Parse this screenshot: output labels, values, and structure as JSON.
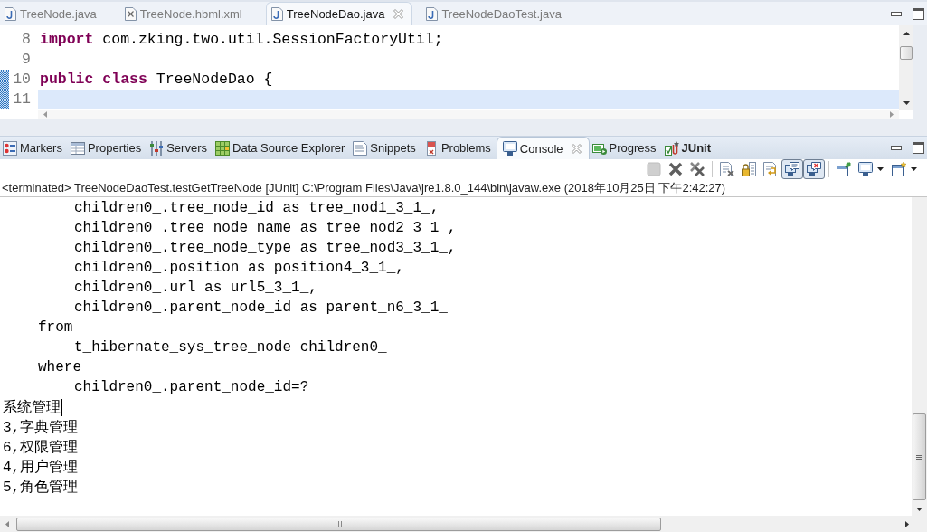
{
  "editor_tabs": [
    {
      "label": "TreeNode.java",
      "kind": "java",
      "selected": false
    },
    {
      "label": "TreeNode.hbml.xml",
      "kind": "xml",
      "selected": false
    },
    {
      "label": "TreeNodeDao.java",
      "kind": "java",
      "selected": true
    },
    {
      "label": "TreeNodeDaoTest.java",
      "kind": "java",
      "selected": false
    }
  ],
  "editor": {
    "lines": [
      {
        "number": "8",
        "marked": false,
        "current": false,
        "tokens": [
          {
            "text": "import",
            "kind": "keyword"
          },
          {
            "text": " com.zking.two.util.SessionFactoryUtil;",
            "kind": "plain"
          }
        ]
      },
      {
        "number": "9",
        "marked": false,
        "current": false
      },
      {
        "number": "10",
        "marked": true,
        "current": false,
        "tokens": [
          {
            "text": "public",
            "kind": "keyword"
          },
          {
            "text": " class",
            "kind": "keyword"
          },
          {
            "text": " TreeNodeDao {",
            "kind": "plain"
          }
        ]
      },
      {
        "number": "11",
        "marked": true,
        "current": true
      }
    ]
  },
  "view_tabs": [
    {
      "label": "Markers",
      "kind": "markers",
      "selected": false,
      "changed": false
    },
    {
      "label": "Properties",
      "kind": "properties",
      "selected": false,
      "changed": false
    },
    {
      "label": "Servers",
      "kind": "servers",
      "selected": false,
      "changed": false
    },
    {
      "label": "Data Source Explorer",
      "kind": "data-source",
      "selected": false,
      "changed": false
    },
    {
      "label": "Snippets",
      "kind": "snippets",
      "selected": false,
      "changed": false
    },
    {
      "label": "Problems",
      "kind": "problems",
      "selected": false,
      "changed": false
    },
    {
      "label": "Console",
      "kind": "console",
      "selected": true,
      "changed": false
    },
    {
      "label": "Progress",
      "kind": "progress",
      "selected": false,
      "changed": false
    },
    {
      "label": "JUnit",
      "kind": "junit",
      "selected": false,
      "changed": true
    }
  ],
  "console": {
    "toolbar_groups": [
      {
        "buttons": [
          {
            "kind": "terminate",
            "disabled": true,
            "pressed": false,
            "dropdown": false
          },
          {
            "kind": "remove-launch",
            "disabled": false,
            "pressed": false,
            "dropdown": false
          },
          {
            "kind": "remove-all",
            "disabled": false,
            "pressed": false,
            "dropdown": false
          }
        ]
      },
      {
        "buttons": [
          {
            "kind": "clear",
            "disabled": false,
            "pressed": false,
            "dropdown": false
          },
          {
            "kind": "scroll-lock",
            "disabled": false,
            "pressed": false,
            "dropdown": false
          },
          {
            "kind": "word-wrap",
            "disabled": false,
            "pressed": false,
            "dropdown": false
          },
          {
            "kind": "show-on-output",
            "disabled": false,
            "pressed": true,
            "dropdown": false
          },
          {
            "kind": "show-on-error",
            "disabled": false,
            "pressed": true,
            "dropdown": false
          }
        ]
      },
      {
        "buttons": [
          {
            "kind": "pin",
            "disabled": false,
            "pressed": false,
            "dropdown": false
          },
          {
            "kind": "display-console",
            "disabled": false,
            "pressed": false,
            "dropdown": true
          },
          {
            "kind": "open-console",
            "disabled": false,
            "pressed": false,
            "dropdown": true
          }
        ]
      }
    ],
    "description": "<terminated> TreeNodeDaoTest.testGetTreeNode [JUnit] C:\\Program Files\\Java\\jre1.8.0_144\\bin\\javaw.exe (2018年10月25日 下午2:42:27)",
    "lines": [
      {
        "text": "children0_.tree_node_id as tree_nod1_3_1_,",
        "kind": "sql-clause",
        "caret": false
      },
      {
        "text": "children0_.tree_node_name as tree_nod2_3_1_,",
        "kind": "sql-clause",
        "caret": false
      },
      {
        "text": "children0_.tree_node_type as tree_nod3_3_1_,",
        "kind": "sql-clause",
        "caret": false
      },
      {
        "text": "children0_.position as position4_3_1_,",
        "kind": "sql-clause",
        "caret": false
      },
      {
        "text": "children0_.url as url5_3_1_,",
        "kind": "sql-clause",
        "caret": false
      },
      {
        "text": "children0_.parent_node_id as parent_n6_3_1_",
        "kind": "sql-clause",
        "caret": false
      },
      {
        "text": "from",
        "kind": "sql-keyword",
        "caret": false
      },
      {
        "text": "t_hibernate_sys_tree_node children0_",
        "kind": "sql-clause",
        "caret": false
      },
      {
        "text": "where",
        "kind": "sql-keyword",
        "caret": false
      },
      {
        "text": "children0_.parent_node_id=?",
        "kind": "sql-clause",
        "caret": false
      },
      {
        "text": "系统管理",
        "kind": "output",
        "caret": true
      },
      {
        "text": "3,字典管理",
        "kind": "output",
        "caret": false
      },
      {
        "text": "6,权限管理",
        "kind": "output",
        "caret": false
      },
      {
        "text": "4,用户管理",
        "kind": "output",
        "caret": false
      },
      {
        "text": "5,角色管理",
        "kind": "output",
        "caret": false
      }
    ]
  }
}
